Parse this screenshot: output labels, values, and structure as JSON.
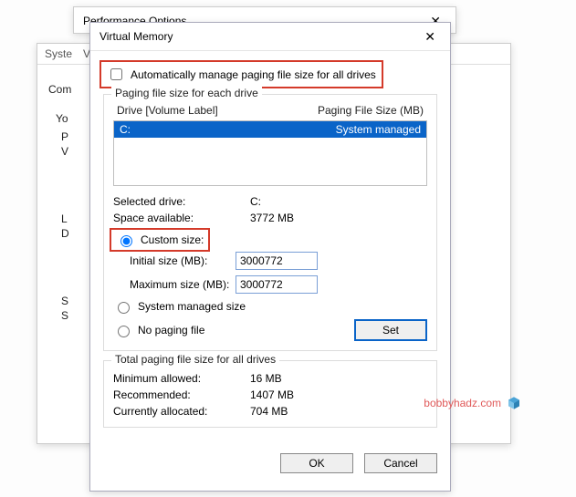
{
  "bgWindow": {
    "tabs": [
      "Syste",
      "Vi"
    ],
    "labels": [
      "Com",
      "Yo",
      "P",
      "V",
      "L",
      "D",
      "S",
      "S"
    ]
  },
  "perfOptions": {
    "title": "Performance Options"
  },
  "vm": {
    "title": "Virtual Memory",
    "autoManage": "Automatically manage paging file size for all drives",
    "group1": {
      "title": "Paging file size for each drive",
      "colDrive": "Drive  [Volume Label]",
      "colSize": "Paging File Size (MB)",
      "rows": [
        {
          "drive": "C:",
          "size": "System managed",
          "selected": true
        }
      ],
      "selectedDriveLabel": "Selected drive:",
      "selectedDriveValue": "C:",
      "spaceAvailLabel": "Space available:",
      "spaceAvailValue": "3772 MB",
      "customSizeLabel": "Custom size:",
      "initialLabel": "Initial size (MB):",
      "initialValue": "3000772",
      "maxLabel": "Maximum size (MB):",
      "maxValue": "3000772",
      "systemManagedLabel": "System managed size",
      "noPagingLabel": "No paging file",
      "setLabel": "Set"
    },
    "group2": {
      "title": "Total paging file size for all drives",
      "minLabel": "Minimum allowed:",
      "minValue": "16 MB",
      "recLabel": "Recommended:",
      "recValue": "1407 MB",
      "curLabel": "Currently allocated:",
      "curValue": "704 MB"
    },
    "okLabel": "OK",
    "cancelLabel": "Cancel"
  },
  "watermark": "bobbyhadz.com"
}
